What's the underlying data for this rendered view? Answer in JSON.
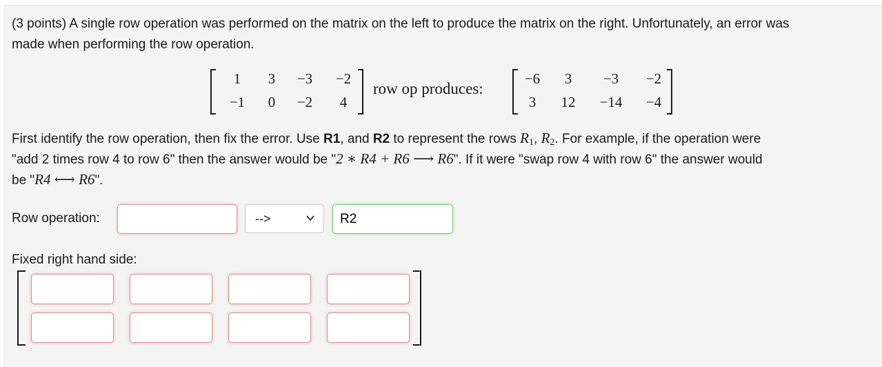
{
  "question": {
    "line1": "(3 points) A single row operation was performed on the matrix on the left to produce the matrix on the right. Unfortunately, an error was",
    "line2": "made when performing the row operation."
  },
  "matrix_left": [
    [
      "1",
      "3",
      "−3",
      "−2"
    ],
    [
      "−1",
      "0",
      "−2",
      "4"
    ]
  ],
  "row_op_text": "row op produces:",
  "matrix_right": [
    [
      "−6",
      "3",
      "−3",
      "−2"
    ],
    [
      "3",
      "12",
      "−14",
      "−4"
    ]
  ],
  "instructions": {
    "p1_a": "First identify the row operation, then fix the error. Use ",
    "r1": "R1",
    "p1_b": ", and ",
    "r2": "R2",
    "p1_c": " to represent the rows ",
    "rows_math_1": "R",
    "rows_sub_1": "1",
    "rows_comma": ", ",
    "rows_math_2": "R",
    "rows_sub_2": "2",
    "p1_d": ". For example, if the operation were",
    "p2_a": "\"add 2 times row 4 to row 6\" then the answer would be \"",
    "p2_math": "2 ∗ R4 + R6 ⟶ R6",
    "p2_b": "\". If it were \"swap row 4 with row 6\" the answer would",
    "p3_a": "be \"",
    "p3_math": "R4 ⟷ R6",
    "p3_b": "\"."
  },
  "row_operation": {
    "label": "Row operation:",
    "input_value": "",
    "select_value": "-->",
    "target_value": "R2"
  },
  "fixed_rhs": {
    "label": "Fixed right hand side:"
  }
}
